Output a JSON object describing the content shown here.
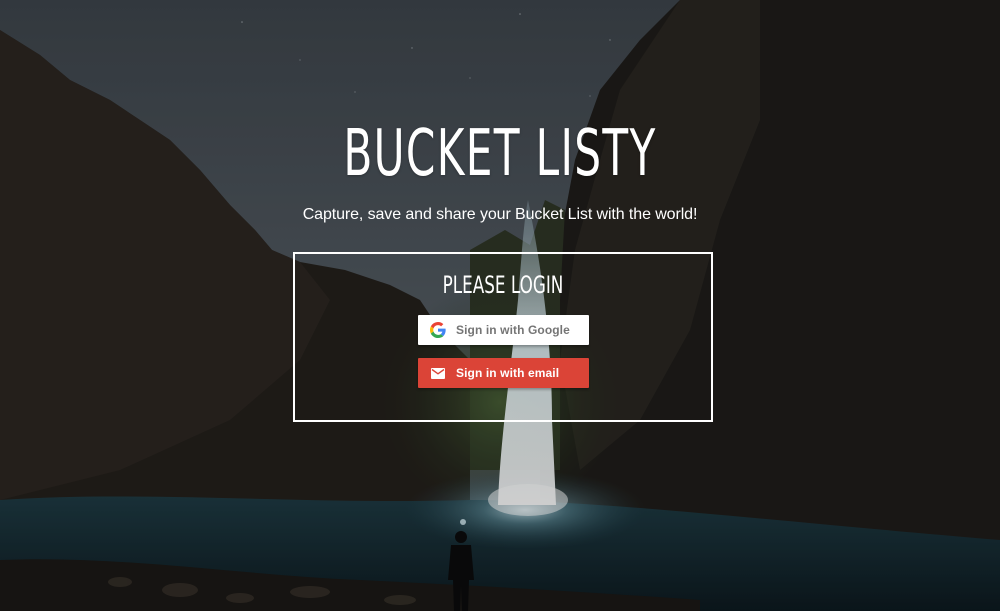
{
  "app": {
    "title": "BUCKET LISTY",
    "tagline": "Capture, save and share your Bucket List with the world!"
  },
  "login": {
    "heading": "PLEASE LOGIN",
    "google_label": "Sign in with Google",
    "email_label": "Sign in with email"
  },
  "icons": {
    "google": "google-g-icon",
    "email": "mail-icon"
  },
  "colors": {
    "email_button": "#db4437",
    "google_button": "#ffffff",
    "text": "#ffffff"
  }
}
